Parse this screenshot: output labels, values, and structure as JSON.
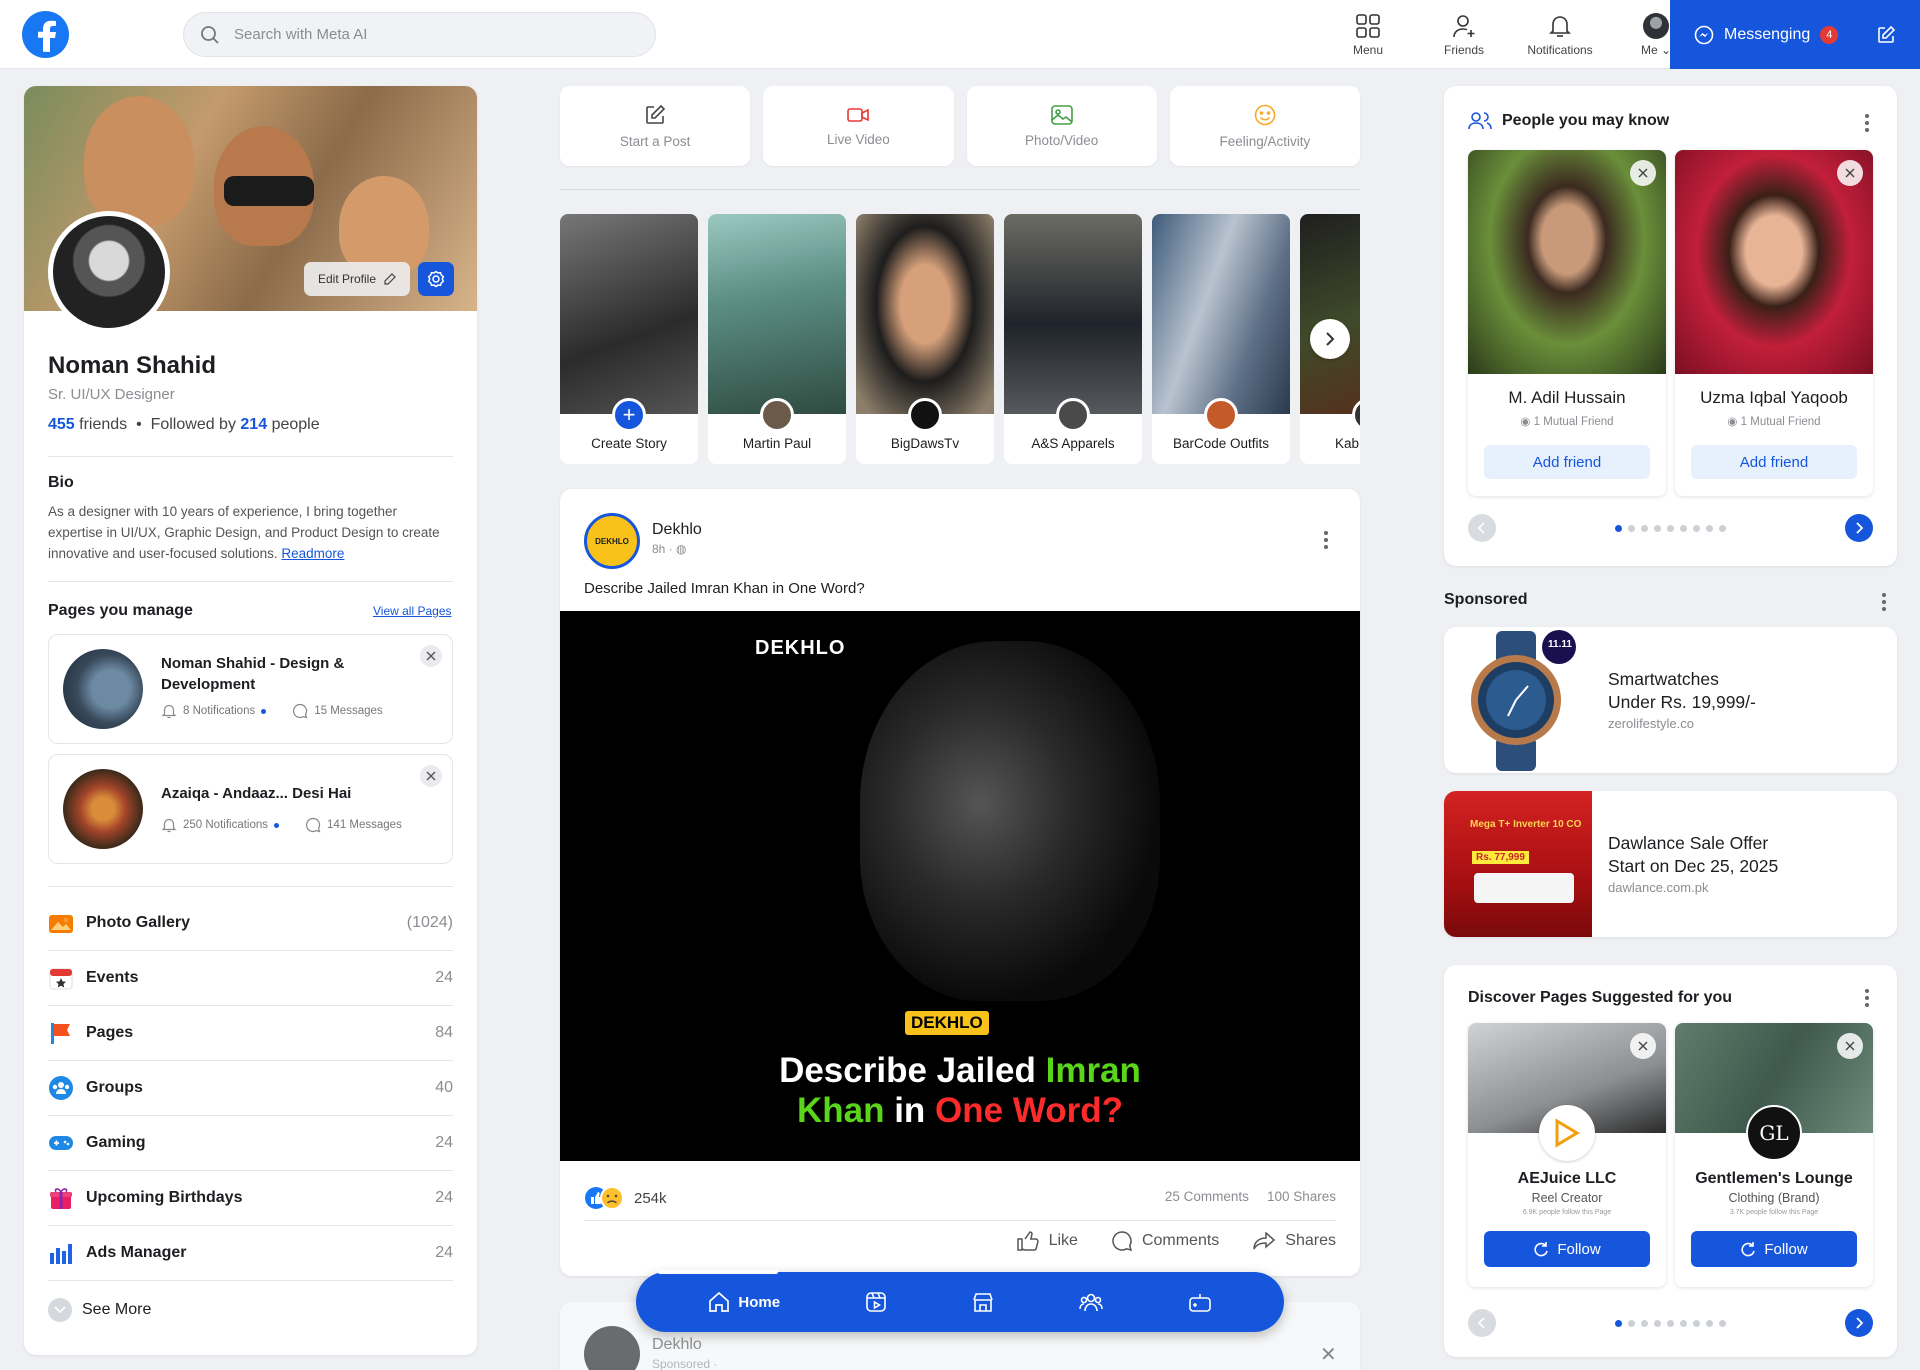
{
  "header": {
    "search_placeholder": "Search with Meta AI",
    "nav": [
      {
        "label": "Menu",
        "icon": "grid-icon"
      },
      {
        "label": "Friends",
        "icon": "user-icon"
      },
      {
        "label": "Notifications",
        "icon": "bell-icon"
      },
      {
        "label": "Me",
        "icon": "avatar"
      }
    ],
    "messaging_label": "Messenging",
    "messaging_badge": "4"
  },
  "profile": {
    "edit_label": "Edit Profile",
    "name": "Noman Shahid",
    "role": "Sr. UI/UX Designer",
    "friends_count": "455",
    "friends_word": "friends",
    "sep": "•",
    "followed_prefix": "Followed by",
    "followers_count": "214",
    "followers_word": "people",
    "bio_title": "Bio",
    "bio_text": "As a designer with 10 years of experience, I  bring together expertise in UI/UX, Graphic Design, and Product Design to create innovative and user-focused solutions.",
    "bio_link": "Readmore"
  },
  "pages_manage": {
    "title": "Pages you manage",
    "view_all": "View all Pages",
    "items": [
      {
        "title": "Noman Shahid - Design & Development",
        "notifications": "8 Notifications",
        "messages": "15 Messages"
      },
      {
        "title": "Azaiqa - Andaaz... Desi Hai",
        "notifications": "250 Notifications",
        "messages": "141 Messages"
      }
    ]
  },
  "menu": [
    {
      "label": "Photo Gallery",
      "count": "(1024)",
      "color": "#f57c00"
    },
    {
      "label": "Events",
      "count": "24",
      "color": "#e53935"
    },
    {
      "label": "Pages",
      "count": "84",
      "color": "#f4511e"
    },
    {
      "label": "Groups",
      "count": "40",
      "color": "#1e88e5"
    },
    {
      "label": "Gaming",
      "count": "24",
      "color": "#1e88e5"
    },
    {
      "label": "Upcoming Birthdays",
      "count": "24",
      "color": "#e91e63"
    },
    {
      "label": "Ads Manager",
      "count": "24",
      "color": "#1e63e5"
    }
  ],
  "see_more": "See More",
  "composer": [
    {
      "label": "Start a Post",
      "icon": "edit-icon",
      "color": "#444444"
    },
    {
      "label": "Live Video",
      "icon": "video-icon",
      "color": "#e53935"
    },
    {
      "label": "Photo/Video",
      "icon": "image-icon",
      "color": "#43a047"
    },
    {
      "label": "Feeling/Activity",
      "icon": "smile-icon",
      "color": "#f9a825"
    }
  ],
  "stories": [
    {
      "name": "Create Story"
    },
    {
      "name": "Martin Paul"
    },
    {
      "name": "BigDawsTv"
    },
    {
      "name": "A&S Apparels"
    },
    {
      "name": "BarCode Outfits"
    },
    {
      "name": "Kab"
    }
  ],
  "post": {
    "author": "Dekhlo",
    "avatar_text": "DEKHLO",
    "time": "8h ·",
    "caption": "Describe Jailed Imran Khan in One Word?",
    "image_brand": "DEKHLO",
    "image_brand2": "DEKHLO",
    "headline_1a": "Describe Jailed ",
    "headline_1b": "Imran",
    "headline_2a": "Khan",
    "headline_2b": " in ",
    "headline_2c": "One Word?",
    "reactions": "254k",
    "comments": "25 Comments",
    "shares": "100 Shares",
    "like_label": "Like",
    "comment_label": "Comments",
    "share_label": "Shares"
  },
  "post2": {
    "author": "Dekhlo",
    "meta": "Sponsored ·"
  },
  "bottom_nav": {
    "home_label": "Home"
  },
  "people": {
    "title": "People you may know",
    "cards": [
      {
        "name": "M. Adil Hussain",
        "mutual": "1 Mutual Friend",
        "button": "Add friend"
      },
      {
        "name": "Uzma Iqbal Yaqoob",
        "mutual": "1 Mutual Friend",
        "button": "Add friend"
      }
    ]
  },
  "sponsored": {
    "title": "Sponsored",
    "ads": [
      {
        "line1": "Smartwatches",
        "line2": "Under Rs. 19,999/-",
        "url": "zerolifestyle.co",
        "badge": "11.11"
      },
      {
        "line1": "Dawlance Sale Offer",
        "line2": "Start on Dec 25, 2025",
        "url": "dawlance.com.pk",
        "promo_title": "Mega T+ Inverter 10 CO",
        "promo_price": "Rs. 77,999"
      }
    ]
  },
  "discover": {
    "title": "Discover Pages Suggested for you",
    "cards": [
      {
        "name": "AEJuice LLC",
        "category": "Reel Creator",
        "followers": "6.9K people follow this Page",
        "button": "Follow"
      },
      {
        "name": "Gentlemen's Lounge",
        "category": "Clothing (Brand)",
        "followers": "3.7K people follow this Page",
        "button": "Follow",
        "logo": "GL"
      }
    ]
  }
}
